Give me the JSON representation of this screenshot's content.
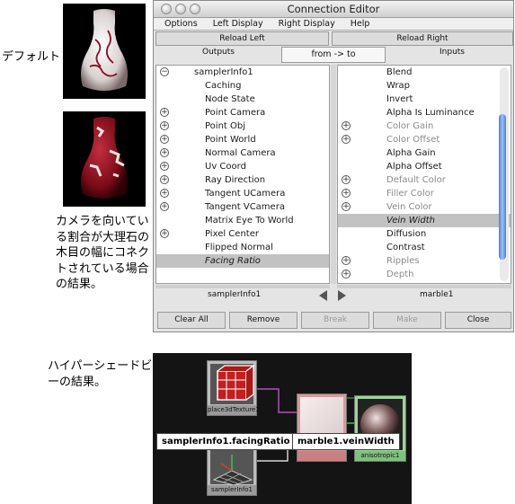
{
  "captions": {
    "default": "デフォルト",
    "result": "カメラを向いている割合が大理石の木目の幅にコネクトされている場合の結果。",
    "hypershade": "ハイパーシェードビューの結果。"
  },
  "window": {
    "title": "Connection Editor",
    "menu": [
      "Options",
      "Left Display",
      "Right Display",
      "Help"
    ],
    "reload_left": "Reload Left",
    "reload_right": "Reload Right",
    "outputs_label": "Outputs",
    "inputs_label": "Inputs",
    "from_to": "from -> to",
    "left_items": [
      {
        "label": "samplerInfo1",
        "expand": "⊖",
        "root": true
      },
      {
        "label": "Caching",
        "expand": ""
      },
      {
        "label": "Node State",
        "expand": ""
      },
      {
        "label": "Point Camera",
        "expand": "⊕"
      },
      {
        "label": "Point Obj",
        "expand": "⊕"
      },
      {
        "label": "Point World",
        "expand": "⊕"
      },
      {
        "label": "Normal Camera",
        "expand": "⊕"
      },
      {
        "label": "Uv Coord",
        "expand": "⊕"
      },
      {
        "label": "Ray Direction",
        "expand": "⊕"
      },
      {
        "label": "Tangent UCamera",
        "expand": "⊕"
      },
      {
        "label": "Tangent VCamera",
        "expand": "⊕"
      },
      {
        "label": "Matrix Eye To World",
        "expand": ""
      },
      {
        "label": "Pixel Center",
        "expand": "⊕"
      },
      {
        "label": "Flipped Normal",
        "expand": ""
      },
      {
        "label": "Facing Ratio",
        "expand": "",
        "selected": true
      }
    ],
    "right_items": [
      {
        "label": "Blend",
        "expand": ""
      },
      {
        "label": "Wrap",
        "expand": ""
      },
      {
        "label": "Invert",
        "expand": ""
      },
      {
        "label": "Alpha Is Luminance",
        "expand": ""
      },
      {
        "label": "Color Gain",
        "expand": "⊕",
        "dim": true
      },
      {
        "label": "Color Offset",
        "expand": "⊕",
        "dim": true
      },
      {
        "label": "Alpha Gain",
        "expand": ""
      },
      {
        "label": "Alpha Offset",
        "expand": ""
      },
      {
        "label": "Default Color",
        "expand": "⊕",
        "dim": true
      },
      {
        "label": "Filler Color",
        "expand": "⊕",
        "dim": true
      },
      {
        "label": "Vein Color",
        "expand": "⊕",
        "dim": true
      },
      {
        "label": "Vein Width",
        "expand": "",
        "selected": true
      },
      {
        "label": "Diffusion",
        "expand": ""
      },
      {
        "label": "Contrast",
        "expand": ""
      },
      {
        "label": "Ripples",
        "expand": "⊕",
        "dim": true
      },
      {
        "label": "Depth",
        "expand": "⊕",
        "dim": true
      }
    ],
    "left_node": "samplerInfo1",
    "right_node": "marble1",
    "buttons": {
      "close_all": "Clear All",
      "remove": "Remove",
      "break": "Break",
      "make": "Make",
      "close": "Close"
    }
  },
  "hypershade": {
    "place_label": "place3dTexture1",
    "marble_label": "",
    "aniso_label": "anisotropic1",
    "sampler_label": "samplerInfo1",
    "tag_left": "samplerInfo1.facingRatio",
    "tag_right": "marble1.veinWidth"
  }
}
